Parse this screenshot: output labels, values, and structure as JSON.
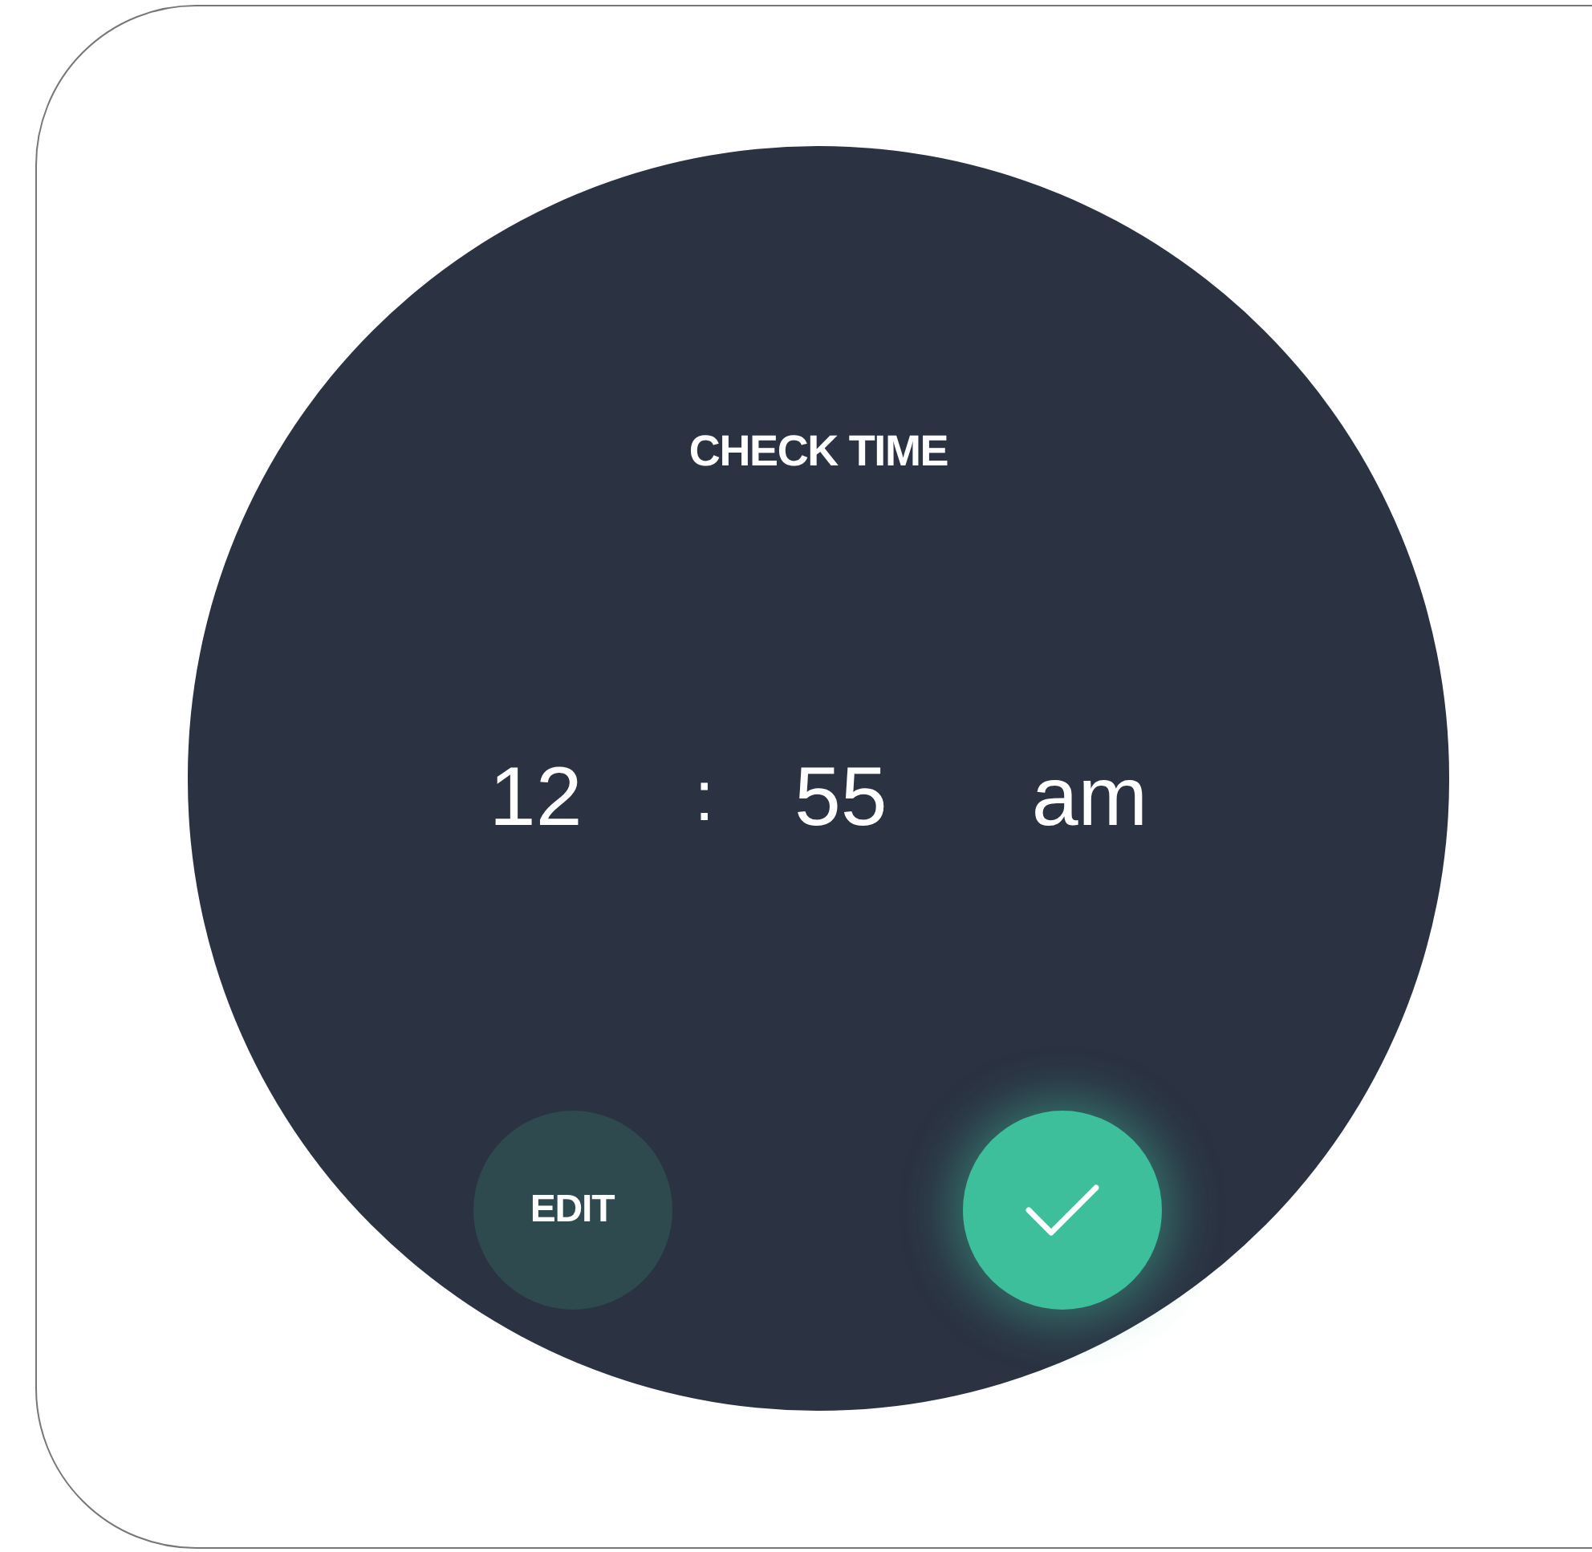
{
  "dialog": {
    "title": "CHECK TIME",
    "time": {
      "hour": "12",
      "separator": ":",
      "minute": "55",
      "period": "am"
    },
    "buttons": [
      {
        "kind": "text",
        "label": "EDIT"
      },
      {
        "kind": "confirm"
      }
    ]
  }
}
